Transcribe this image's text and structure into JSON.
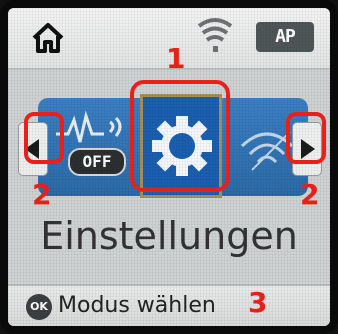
{
  "statusbar": {
    "home_icon": "home-icon",
    "wifi_icon": "wifi-icon",
    "ap_label": "AP"
  },
  "carousel": {
    "left_tile_badge": "OFF",
    "center_icon": "gear-icon",
    "right_tile_icon": "wifi-settings-icon"
  },
  "title": "Einstellungen",
  "bottom": {
    "ok_label": "OK",
    "hint": "Modus wählen"
  },
  "annotations": {
    "n1": "1",
    "n2_left": "2",
    "n2_right": "2",
    "n3": "3"
  },
  "colors": {
    "annotation": "#e8201a",
    "band": "#2c6aa8",
    "screen": "#cfd2d3"
  }
}
